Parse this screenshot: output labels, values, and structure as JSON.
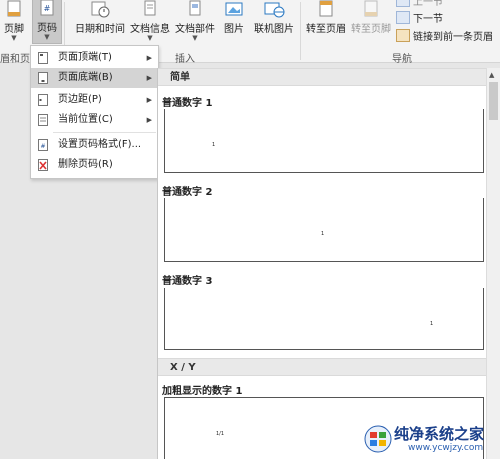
{
  "ribbon": {
    "buttons": {
      "footer": "页脚",
      "page_number": "页码",
      "date_time": "日期和时间",
      "doc_info": "文档信息",
      "doc_parts": "文档部件",
      "picture": "图片",
      "online_picture": "联机图片",
      "goto_header": "转至页眉",
      "goto_footer": "转至页脚",
      "prev_section_partial": "上一节",
      "next_section": "下一节",
      "link_previous": "链接到前一条页眉"
    },
    "groups": {
      "header_footer": "眉和页脚",
      "insert": "插入",
      "navigation": "导航"
    }
  },
  "menu": {
    "items": [
      {
        "label": "页面顶端(T)",
        "has_submenu": true
      },
      {
        "label": "页面底端(B)",
        "has_submenu": true,
        "active": true
      },
      {
        "label": "页边距(P)",
        "has_submenu": true
      },
      {
        "label": "当前位置(C)",
        "has_submenu": true
      },
      {
        "label": "设置页码格式(F)...",
        "has_submenu": false
      },
      {
        "label": "删除页码(R)",
        "has_submenu": false
      }
    ]
  },
  "gallery": {
    "sections": [
      {
        "title": "简单",
        "items": [
          {
            "title": "普通数字 1",
            "sample": "1"
          },
          {
            "title": "普通数字 2",
            "sample": "1"
          },
          {
            "title": "普通数字 3",
            "sample": "1"
          }
        ]
      },
      {
        "title": "X / Y",
        "items": [
          {
            "title": "加粗显示的数字 1",
            "sample": "1/1"
          }
        ]
      }
    ]
  },
  "watermark": {
    "text": "纯净系统之家",
    "url": "www.ycwjzy.com"
  },
  "colors": {
    "accent_active": "#d4d4d4",
    "ribbon_bg": "#f3f3f3",
    "watermark_blue": "#1a3f8a"
  }
}
